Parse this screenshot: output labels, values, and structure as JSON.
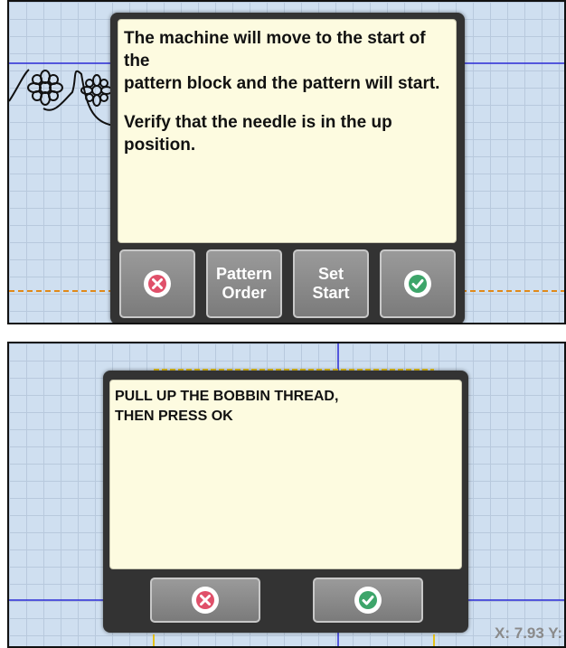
{
  "dialog_top": {
    "message_line1": "The machine will move to the start of the",
    "message_line2": "pattern block and the pattern will start.",
    "message_line3": "Verify that the needle is in the up",
    "message_line4": "position.",
    "buttons": {
      "cancel_icon": "x-circle-icon",
      "pattern_order_line1": "Pattern",
      "pattern_order_line2": "Order",
      "set_start_line1": "Set",
      "set_start_line2": "Start",
      "ok_icon": "check-circle-icon"
    }
  },
  "dialog_bottom": {
    "message_line1": "PULL UP THE BOBBIN THREAD,",
    "message_line2": "THEN PRESS OK",
    "buttons": {
      "cancel_icon": "x-circle-icon",
      "ok_icon": "check-circle-icon"
    }
  },
  "coordinates_readout": "X:  7.93 Y:",
  "colors": {
    "grid_background": "#cfdff0",
    "grid_line": "#b8c9dd",
    "axis_line": "#2a2ad6",
    "orange_guide": "#e08a1a",
    "yellow_guide": "#e6c21a",
    "dialog_frame": "#333333",
    "message_background": "#fdfbe0",
    "cancel_red": "#e0506a",
    "ok_green": "#3da56a"
  }
}
